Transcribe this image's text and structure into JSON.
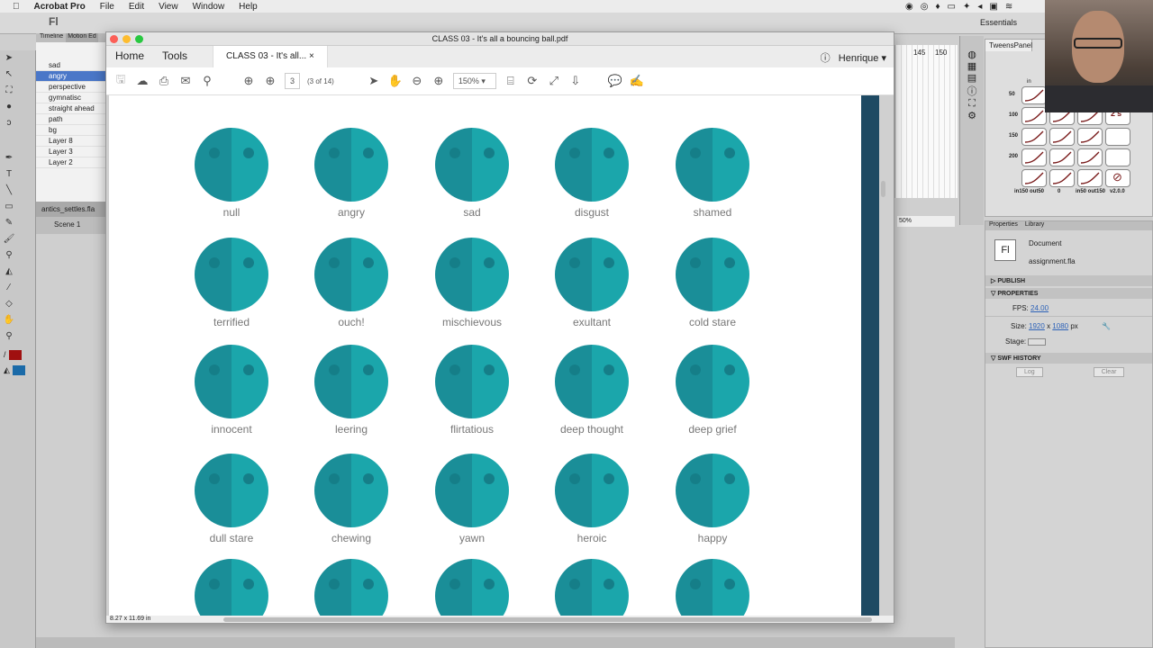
{
  "menubar": {
    "app": "Acrobat Pro",
    "items": [
      "File",
      "Edit",
      "View",
      "Window",
      "Help"
    ]
  },
  "flash": {
    "logo": "Fl",
    "workspace": "Essentials",
    "layers": [
      "sad",
      "angry",
      "perspective",
      "gymnatisc",
      "straight ahead",
      "path",
      "bg",
      "Layer 8",
      "Layer 3",
      "Layer 2"
    ],
    "selected_layer": "angry",
    "timeline_tabs": [
      "Timeline",
      "Motion Ed"
    ],
    "file_tab": "antics_settles.fla",
    "scene": "Scene 1",
    "ruler_numbers": [
      "145",
      "150"
    ],
    "zoom": "50%",
    "colors": {
      "stroke": "#a01010",
      "fill": "#1a6aa8"
    }
  },
  "acrobat": {
    "window_title": "CLASS 03 - It's all a bouncing ball.pdf",
    "nav": {
      "home": "Home",
      "tools": "Tools",
      "tab": "CLASS 03 - It's all...",
      "user": "Henrique"
    },
    "toolbar": {
      "page": "3",
      "page_of": "(3 of 14)",
      "zoom": "150%"
    },
    "page_size": "8.27 x 11.69 in"
  },
  "faces": [
    "null",
    "angry",
    "sad",
    "disgust",
    "shamed",
    "terrified",
    "ouch!",
    "mischievous",
    "exultant",
    "cold stare",
    "innocent",
    "leering",
    "flirtatious",
    "deep thought",
    "deep grief",
    "dull stare",
    "chewing",
    "yawn",
    "heroic",
    "happy",
    "",
    "",
    "",
    "",
    ""
  ],
  "tweens": {
    "title": "TweensPanel",
    "in_label": "in",
    "rows": [
      "50",
      "100",
      "150",
      "200"
    ],
    "footer": [
      "in150 out50",
      "0",
      "in50 out150",
      "v2.0.0"
    ],
    "twos": "2's"
  },
  "properties": {
    "tabs": [
      "Properties",
      "Library"
    ],
    "doc_type": "Document",
    "doc_name": "assignment.fla",
    "publish": "PUBLISH",
    "properties": "PROPERTIES",
    "fps_label": "FPS:",
    "fps": "24.00",
    "size_label": "Size:",
    "width": "1920",
    "x": "x",
    "height": "1080",
    "unit": "px",
    "stage_label": "Stage:",
    "swf_history": "SWF HISTORY",
    "log": "Log",
    "clear": "Clear"
  }
}
